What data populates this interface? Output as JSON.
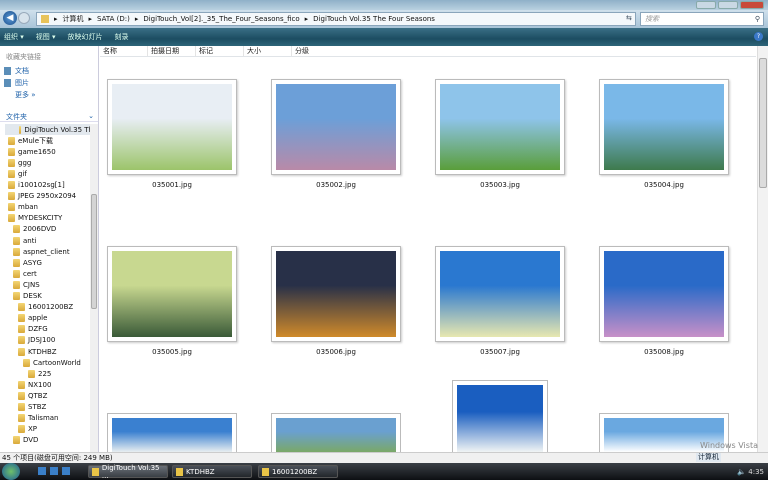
{
  "window": {
    "search_placeholder": "搜索"
  },
  "address": {
    "crumbs": [
      "计算机",
      "SATA (D:)",
      "DigiTouch_Vol[2]._35_The_Four_Seasons_fico",
      "DigiTouch Vol.35 The Four Seasons"
    ]
  },
  "toolbar": {
    "organize": "组织 ▾",
    "views": "视图 ▾",
    "slideshow": "放映幻灯片",
    "burn": "刻录",
    "help": "?"
  },
  "sidebar": {
    "favorites_heading": "收藏夹链接",
    "favorites": [
      "文档",
      "图片",
      "更多 »"
    ],
    "folders_heading": "文件夹",
    "tree": [
      {
        "label": "DigiTouch Vol.35 Th",
        "level": 1,
        "selected": true
      },
      {
        "label": "eMule下载",
        "level": 0
      },
      {
        "label": "game1650",
        "level": 0
      },
      {
        "label": "ggg",
        "level": 0
      },
      {
        "label": "gif",
        "level": 0
      },
      {
        "label": "i100102sg[1]",
        "level": 0
      },
      {
        "label": "JPEG 2950x2094",
        "level": 0
      },
      {
        "label": "mban",
        "level": 0
      },
      {
        "label": "MYDESKCITY",
        "level": 0
      },
      {
        "label": "2006DVD",
        "level": 1
      },
      {
        "label": "anti",
        "level": 1
      },
      {
        "label": "aspnet_client",
        "level": 1
      },
      {
        "label": "ASYG",
        "level": 1
      },
      {
        "label": "cert",
        "level": 1
      },
      {
        "label": "CJNS",
        "level": 1
      },
      {
        "label": "DESK",
        "level": 1
      },
      {
        "label": "16001200BZ",
        "level": 2
      },
      {
        "label": "apple",
        "level": 2
      },
      {
        "label": "DZFG",
        "level": 2
      },
      {
        "label": "JDSJ100",
        "level": 2
      },
      {
        "label": "KTDHBZ",
        "level": 2
      },
      {
        "label": "CartoonWorld",
        "level": 3
      },
      {
        "label": "225",
        "level": 4
      },
      {
        "label": "NX100",
        "level": 2
      },
      {
        "label": "QTBZ",
        "level": 2
      },
      {
        "label": "STBZ",
        "level": 2
      },
      {
        "label": "Talisman",
        "level": 2
      },
      {
        "label": "XP",
        "level": 2
      },
      {
        "label": "DVD",
        "level": 1
      }
    ]
  },
  "columns": [
    "名称",
    "拍摄日期",
    "标记",
    "大小",
    "分级"
  ],
  "files": [
    {
      "name": "035001.jpg",
      "colors": [
        "#e8eef4",
        "#9cc46a"
      ]
    },
    {
      "name": "035002.jpg",
      "colors": [
        "#6c9fd8",
        "#b98aa8"
      ]
    },
    {
      "name": "035003.jpg",
      "colors": [
        "#8ec4ea",
        "#5a9e3a"
      ]
    },
    {
      "name": "035004.jpg",
      "colors": [
        "#7ab8e8",
        "#3e7a4c"
      ]
    },
    {
      "name": "035005.jpg",
      "colors": [
        "#c8d890",
        "#3a5a38"
      ]
    },
    {
      "name": "035006.jpg",
      "colors": [
        "#283048",
        "#d08a2a"
      ]
    },
    {
      "name": "035007.jpg",
      "colors": [
        "#2a78d0",
        "#e8e8b0"
      ]
    },
    {
      "name": "035008.jpg",
      "colors": [
        "#2a6ac8",
        "#c890c8"
      ]
    },
    {
      "name": "",
      "colors": [
        "#3a80d0",
        "#e8eef0"
      ]
    },
    {
      "name": "",
      "colors": [
        "#6aa0d0",
        "#7aa868"
      ]
    },
    {
      "name": "",
      "colors": [
        "#1a5ec0",
        "#f0f4f4"
      ]
    },
    {
      "name": "",
      "colors": [
        "#6aa8e0",
        "#ffffff"
      ]
    }
  ],
  "status": "45 个项目(磁盘可用空间: 249 MB)",
  "taskbar": {
    "tasks": [
      "DigiTouch Vol.35 ...",
      "KTDHBZ",
      "16001200BZ"
    ],
    "clock": "4:35",
    "computer_label": "计算机"
  },
  "watermark": "Windows Vista"
}
